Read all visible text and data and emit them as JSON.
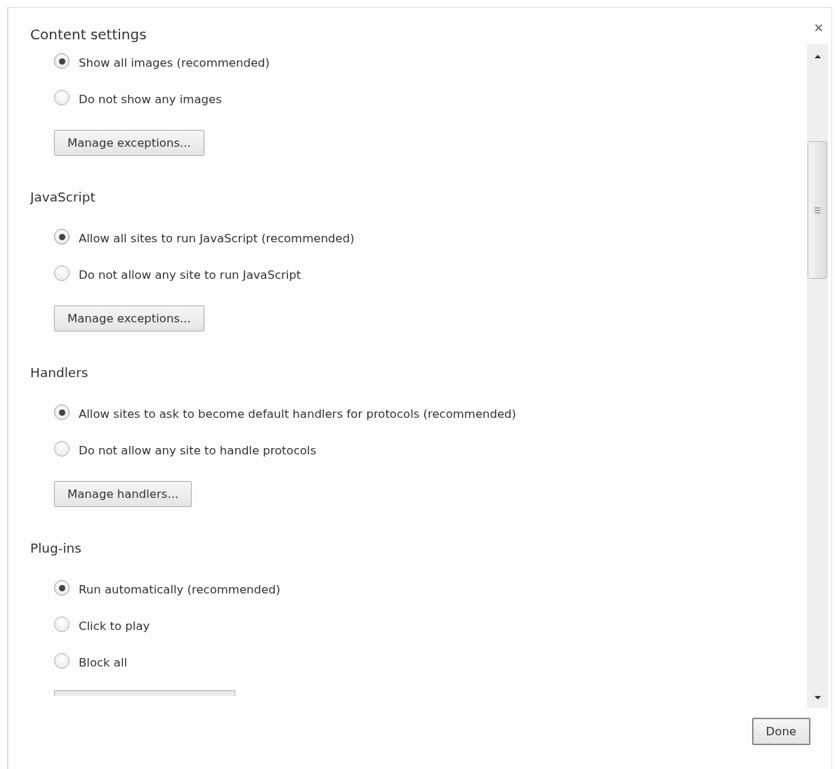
{
  "dialog": {
    "title": "Content settings",
    "close": "×"
  },
  "sections": [
    {
      "options": [
        {
          "label": "Show all images (recommended)",
          "selected": true
        },
        {
          "label": "Do not show any images",
          "selected": false
        }
      ],
      "button": "Manage exceptions..."
    },
    {
      "heading": "JavaScript",
      "options": [
        {
          "label": "Allow all sites to run JavaScript (recommended)",
          "selected": true
        },
        {
          "label": "Do not allow any site to run JavaScript",
          "selected": false
        }
      ],
      "button": "Manage exceptions..."
    },
    {
      "heading": "Handlers",
      "options": [
        {
          "label": "Allow sites to ask to become default handlers for protocols (recommended)",
          "selected": true
        },
        {
          "label": "Do not allow any site to handle protocols",
          "selected": false
        }
      ],
      "button": "Manage handlers..."
    },
    {
      "heading": "Plug-ins",
      "options": [
        {
          "label": "Run automatically (recommended)",
          "selected": true
        },
        {
          "label": "Click to play",
          "selected": false
        },
        {
          "label": "Block all",
          "selected": false
        }
      ],
      "button_cut_off": true
    }
  ],
  "done_button": "Done"
}
